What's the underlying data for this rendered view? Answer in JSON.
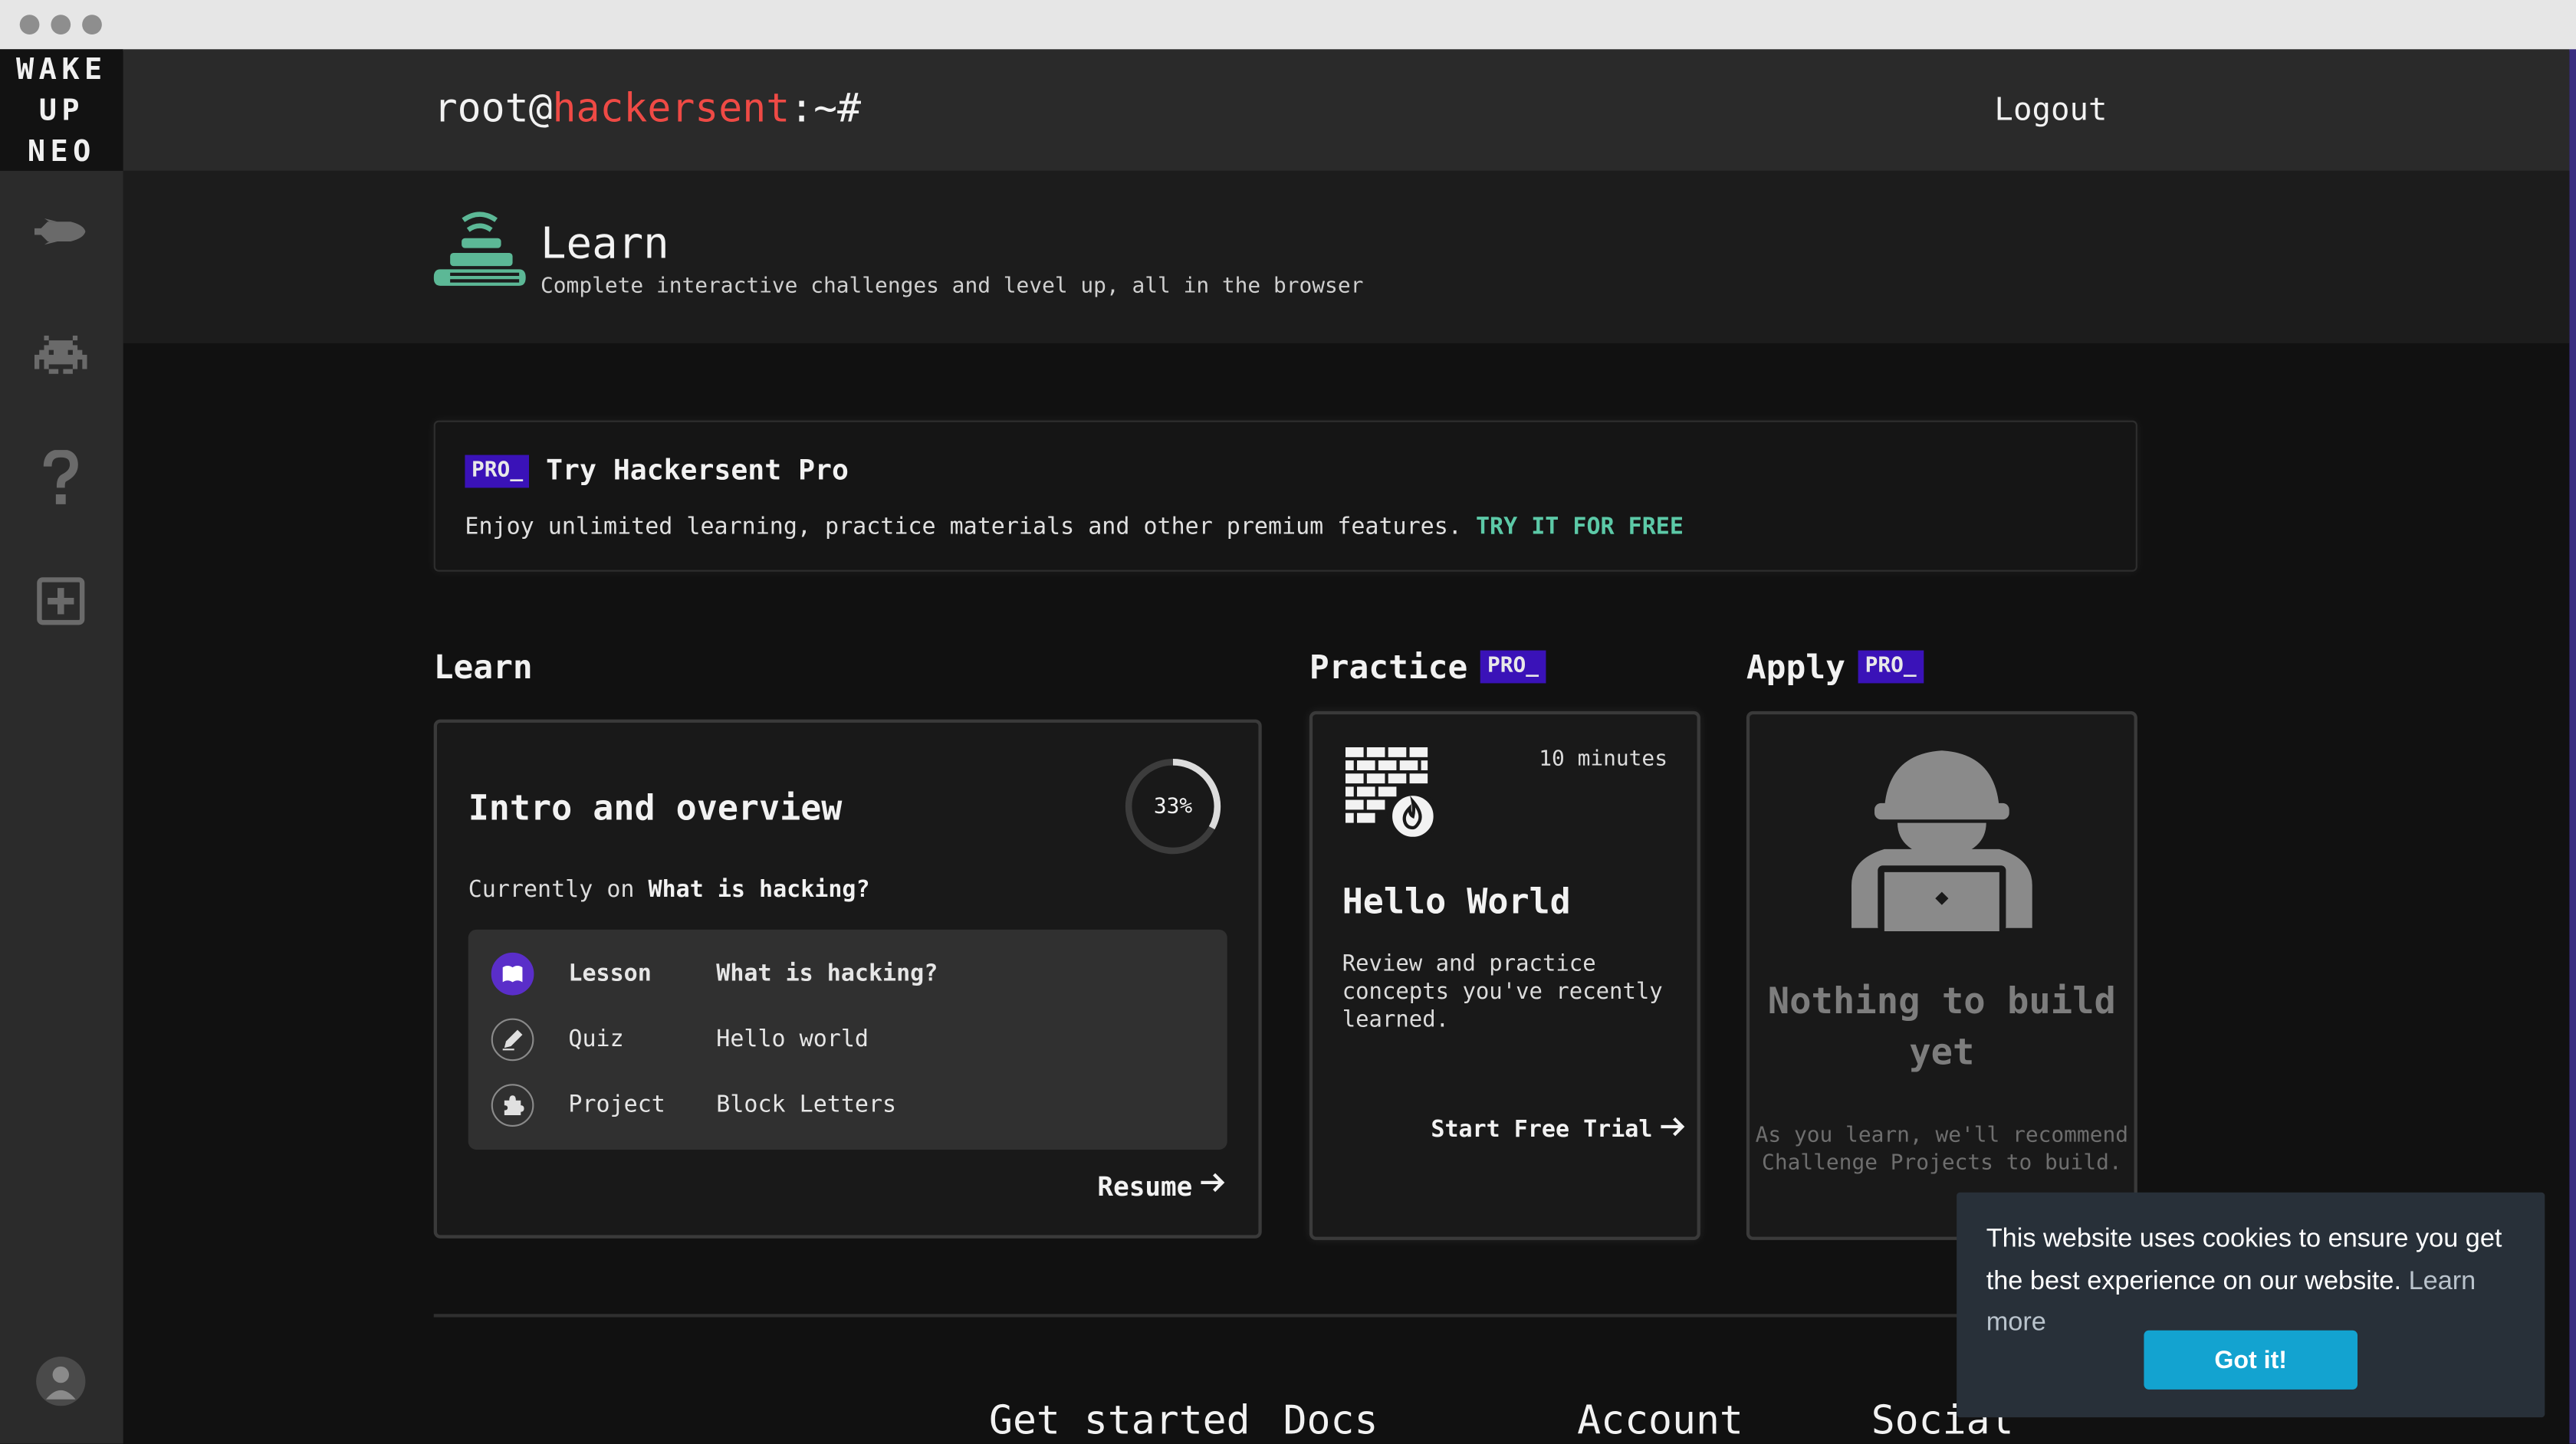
{
  "sidebar": {
    "logo_lines": [
      "WAKE",
      "UP",
      "NEO"
    ],
    "icons": [
      "rocket-icon",
      "space-invader-icon",
      "help-icon",
      "add-box-icon",
      "avatar"
    ]
  },
  "topbar": {
    "prompt_user": "root@",
    "prompt_host": "hackersent",
    "prompt_suffix": ":~#",
    "logout_label": "Logout"
  },
  "header": {
    "title": "Learn",
    "subtitle": "Complete interactive challenges and level up, all in the browser"
  },
  "promo": {
    "badge": "PRO_",
    "title": "Try Hackersent Pro",
    "description": "Enjoy unlimited learning, practice materials and other premium features.",
    "cta": "TRY IT FOR FREE"
  },
  "learn": {
    "section_title": "Learn",
    "course_title": "Intro and overview",
    "progress_label": "33%",
    "progress_value": 0.33,
    "currently_prefix": "Currently on",
    "currently_item": "What is hacking?",
    "items": [
      {
        "type": "Lesson",
        "name": "What is hacking?"
      },
      {
        "type": "Quiz",
        "name": "Hello world"
      },
      {
        "type": "Project",
        "name": "Block Letters"
      }
    ],
    "resume_label": "Resume"
  },
  "practice": {
    "section_title": "Practice",
    "badge": "PRO_",
    "minutes": "10 minutes",
    "title": "Hello World",
    "description": "Review and practice concepts you've recently learned.",
    "cta": "Start Free Trial"
  },
  "apply": {
    "section_title": "Apply",
    "badge": "PRO_",
    "empty_title": "Nothing to build yet",
    "empty_description": "As you learn, we'll recommend Challenge Projects to build."
  },
  "footer": {
    "links": [
      "Get started",
      "Docs",
      "Account",
      "Social"
    ]
  },
  "cookie": {
    "message": "This website uses cookies to ensure you get the best experience on our website.",
    "learn_more": "Learn more",
    "accept": "Got it!"
  },
  "colors": {
    "accent_green": "#5cc9a7",
    "accent_red": "#ef4a45",
    "pro_badge": "#3a12b8",
    "active_item": "#5a2ec9",
    "cookie_button": "#13a3d0"
  }
}
